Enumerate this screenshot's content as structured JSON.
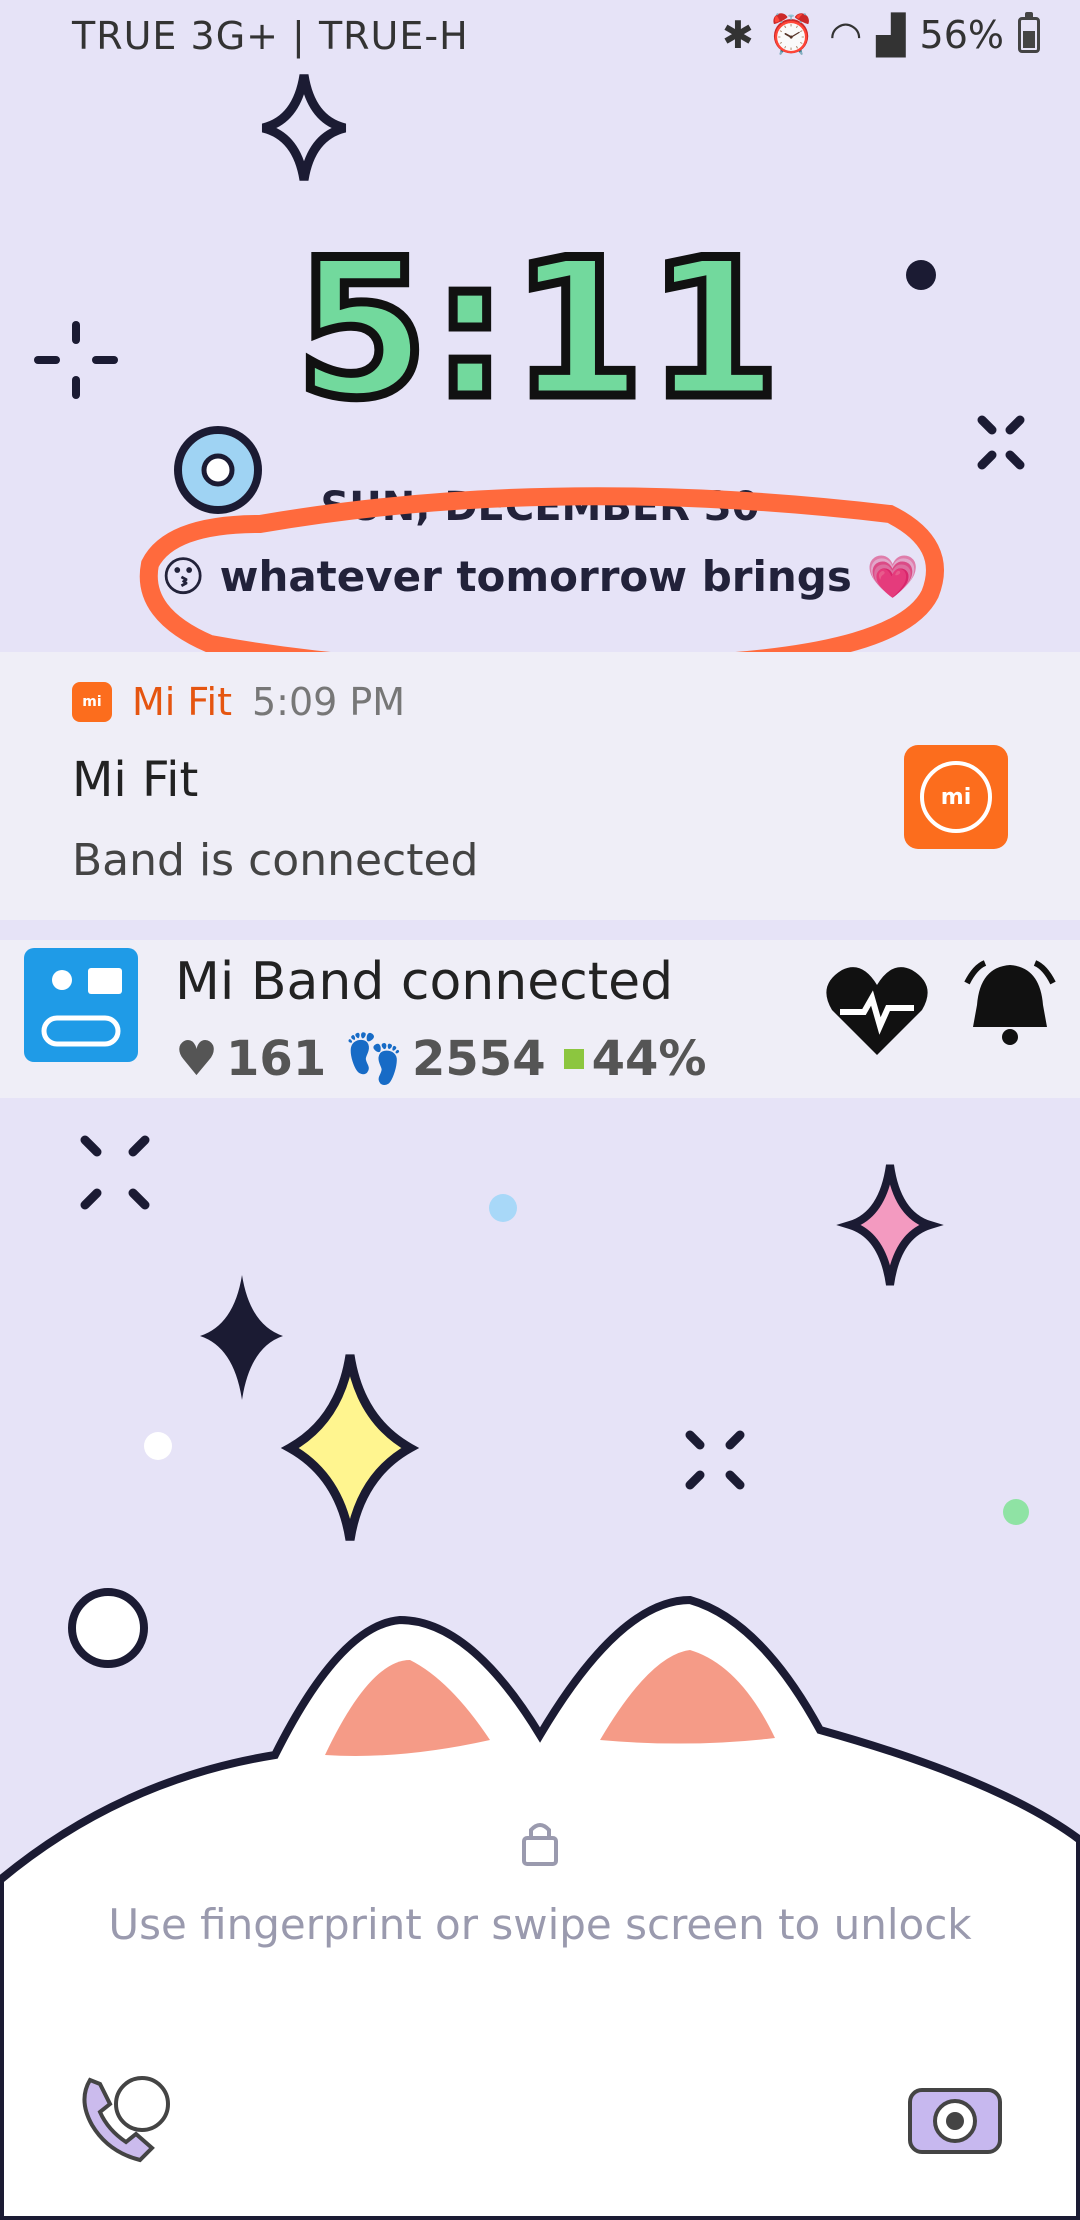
{
  "status_bar": {
    "carrier": "TRUE 3G+ | TRUE-H",
    "battery": "56%",
    "battery_level": 0.56,
    "icons": [
      "bluetooth-icon",
      "alarm-icon",
      "wifi-icon",
      "signal-icon",
      "battery-icon"
    ]
  },
  "clock": {
    "time": "5:11",
    "date": "SUN, DECEMBER 30",
    "status_message": "😗 whatever tomorrow brings 💗"
  },
  "notifications": {
    "mifit": {
      "app_name": "Mi Fit",
      "time": "5:09 PM",
      "title": "Mi Fit",
      "text": "Band is connected",
      "badge": "mi"
    },
    "miband": {
      "title": "Mi Band connected",
      "heart_rate": "161",
      "steps": "2554",
      "battery": "44%"
    }
  },
  "lock": {
    "hint": "Use fingerprint or swipe screen to unlock"
  },
  "colors": {
    "background": "#e6e3f7",
    "clock_fill": "#72d99d",
    "mifit_orange": "#fc6d1d",
    "annotation": "#ff6a3d",
    "band_blue": "#1f9be7"
  }
}
